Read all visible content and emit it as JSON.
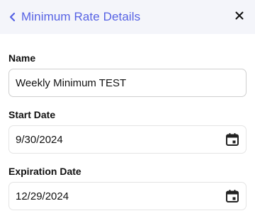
{
  "header": {
    "title": "Minimum Rate Details",
    "back_icon": "chevron-left-icon",
    "close_icon": "close-icon",
    "accent_color": "#5662e4"
  },
  "form": {
    "name": {
      "label": "Name",
      "value": "Weekly Minimum TEST"
    },
    "start_date": {
      "label": "Start Date",
      "value": "9/30/2024",
      "icon": "calendar-icon"
    },
    "expiration_date": {
      "label": "Expiration Date",
      "value": "12/29/2024",
      "icon": "calendar-icon"
    }
  }
}
